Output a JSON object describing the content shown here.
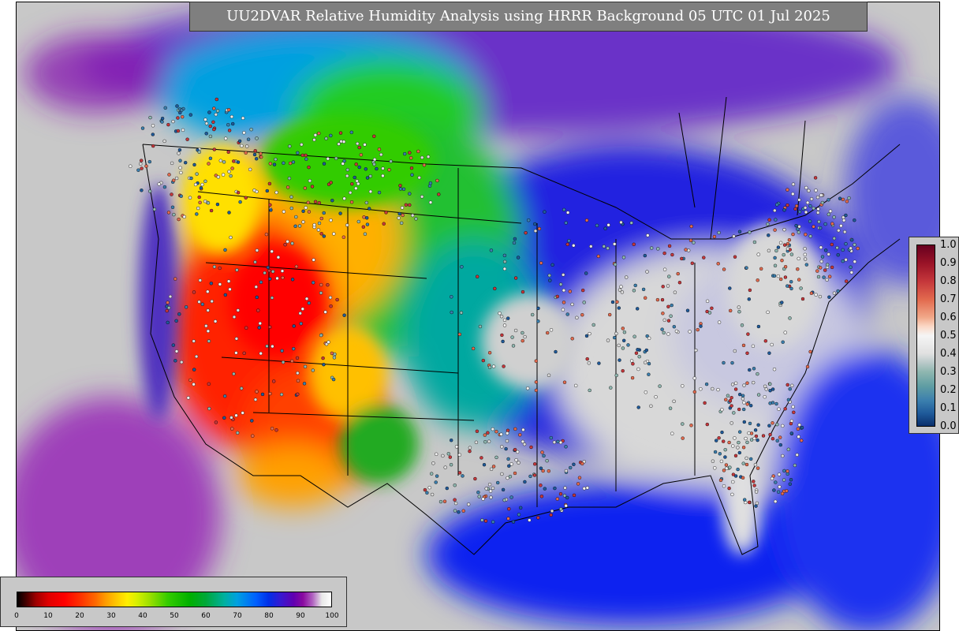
{
  "title": "UU2DVAR Relative Humidity Analysis using HRRR Background 05 UTC 01 Jul 2025",
  "map": {
    "region": "CONUS",
    "field": "relative humidity"
  },
  "obs_colorbar": {
    "ticks": [
      "1.0",
      "0.9",
      "0.8",
      "0.7",
      "0.6",
      "0.5",
      "0.4",
      "0.3",
      "0.2",
      "0.1",
      "0.0"
    ]
  },
  "rh_colorbar": {
    "ticks": [
      "0",
      "10",
      "20",
      "30",
      "40",
      "50",
      "60",
      "70",
      "80",
      "90",
      "100"
    ]
  },
  "colors": {
    "ocean_background": "#c8c8c8",
    "title_background": "#7f7f7f",
    "dry": "#ff0000",
    "moist": "#0030e8",
    "saturated": "#8a0aa0"
  }
}
